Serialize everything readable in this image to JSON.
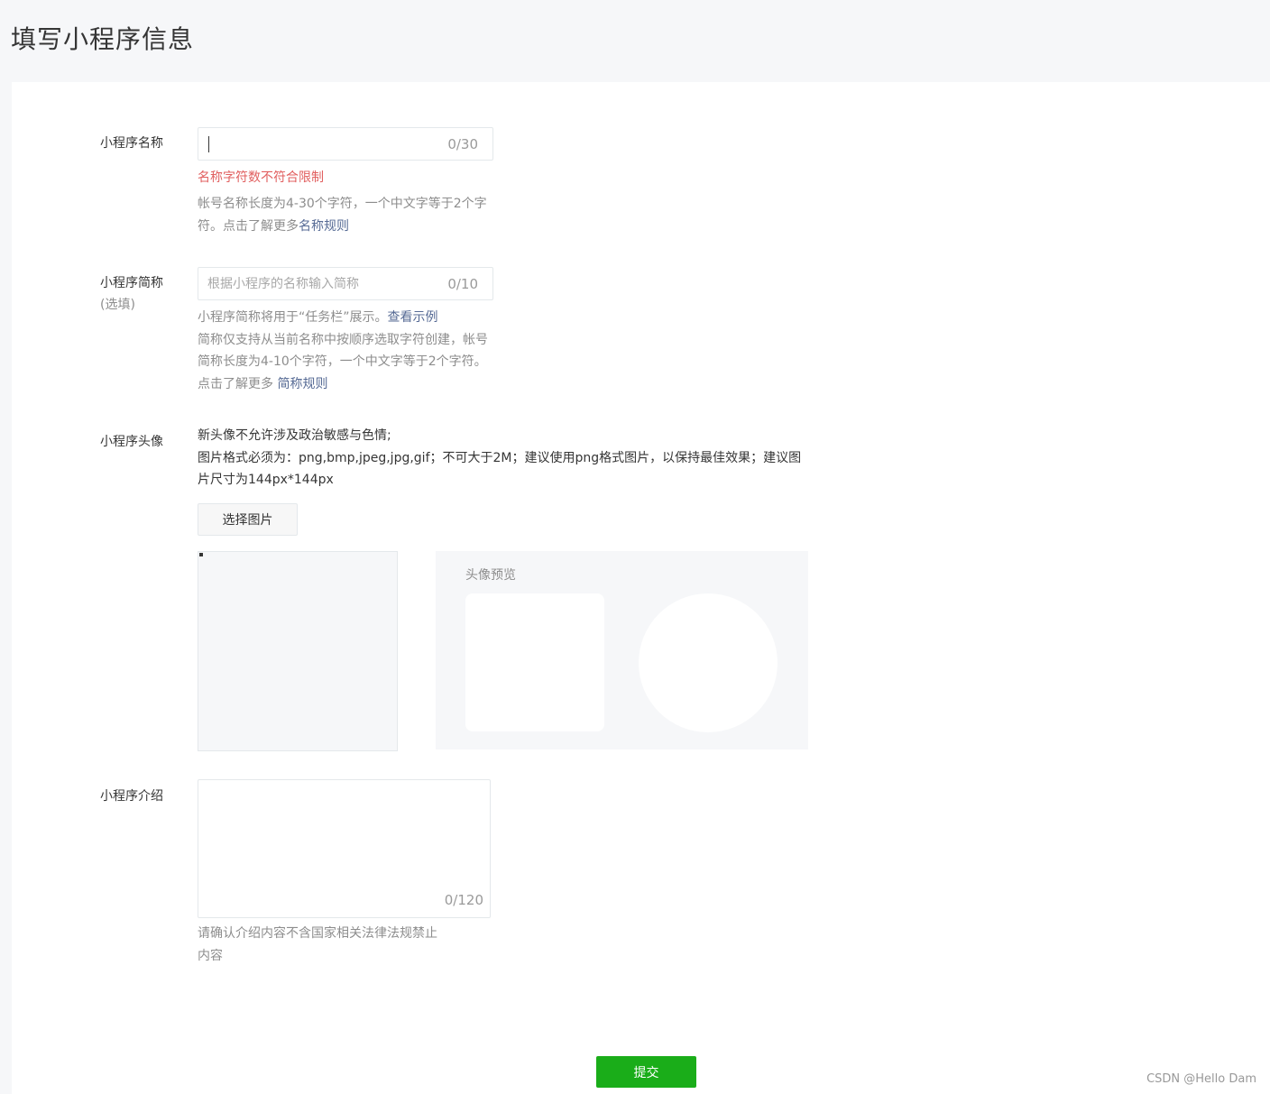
{
  "page_title": "填写小程序信息",
  "name_field": {
    "label": "小程序名称",
    "value": "",
    "counter": "0/30",
    "error": "名称字符数不符合限制",
    "tip_text": "帐号名称长度为4-30个字符，一个中文字等于2个字符。点击了解更多",
    "tip_link": "名称规则"
  },
  "short_name_field": {
    "label": "小程序简称",
    "label_sub": "(选填)",
    "placeholder": "根据小程序的名称输入简称",
    "counter": "0/10",
    "tip_text_1": "小程序简称将用于“任务栏”展示。",
    "tip_link_1": "查看示例",
    "tip_text_2": "简称仅支持从当前名称中按顺序选取字符创建，帐号简称长度为4-10个字符，一个中文字等于2个字符。点击了解更多 ",
    "tip_link_2": "简称规则"
  },
  "avatar_field": {
    "label": "小程序头像",
    "desc_line1": "新头像不允许涉及政治敏感与色情;",
    "desc_line2": "图片格式必须为：png,bmp,jpeg,jpg,gif；不可大于2M；建议使用png格式图片，以保持最佳效果；建议图片尺寸为144px*144px",
    "select_button": "选择图片",
    "preview_title": "头像预览"
  },
  "intro_field": {
    "label": "小程序介绍",
    "value": "",
    "counter": "0/120",
    "tip": "请确认介绍内容不含国家相关法律法规禁止内容"
  },
  "submit_label": "提交",
  "watermark": "CSDN @Hello Dam",
  "colors": {
    "primary": "#1aad19",
    "error": "#e15f5f",
    "link": "#576b95",
    "muted": "#8d8d8d"
  }
}
